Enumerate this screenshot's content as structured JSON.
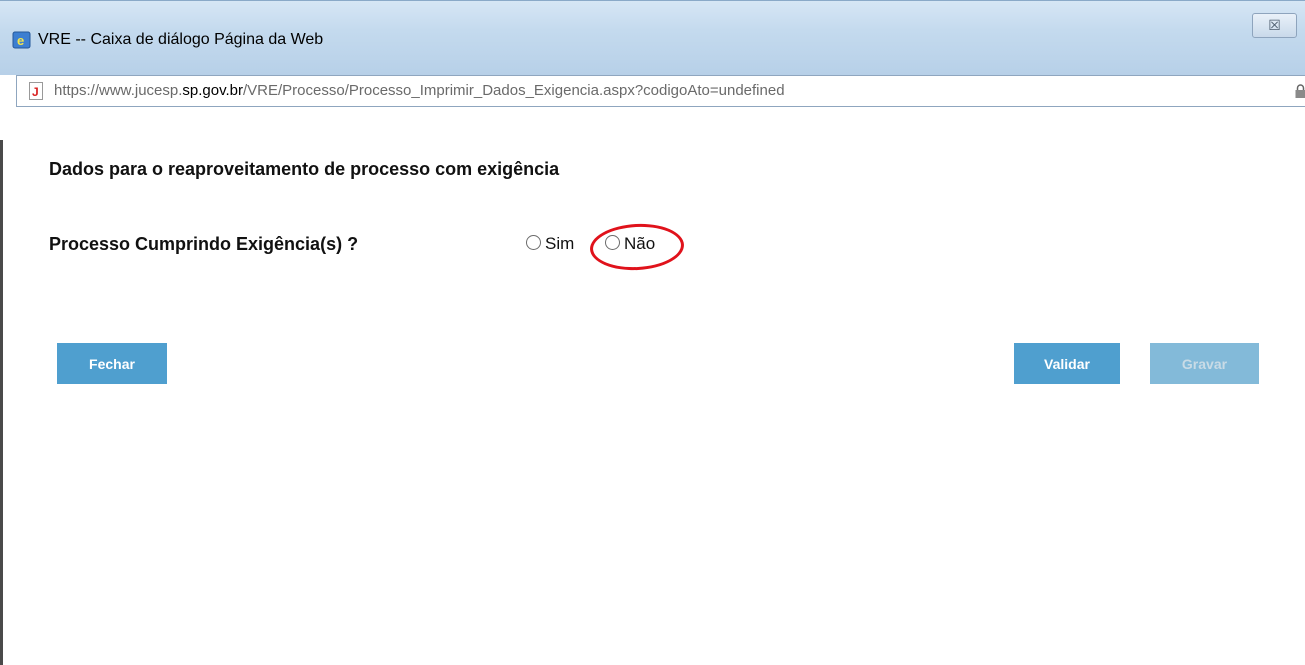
{
  "window": {
    "title": "VRE -- Caixa de diálogo Página da Web",
    "close_glyph": "☒"
  },
  "address_bar": {
    "url_prefix": "https://www.jucesp.",
    "url_host_bold": "sp.gov.br",
    "url_path": "/VRE/Processo/Processo_Imprimir_Dados_Exigencia.aspx?codigoAto=undefined"
  },
  "form": {
    "heading": "Dados para o reaproveitamento de processo com exigência",
    "question_label": "Processo Cumprindo Exigência(s) ?",
    "options": [
      {
        "label": "Sim",
        "selected": false
      },
      {
        "label": "Não",
        "selected": false,
        "highlighted": true
      }
    ]
  },
  "buttons": {
    "close_label": "Fechar",
    "validate_label": "Validar",
    "save_label": "Gravar",
    "save_disabled": true
  },
  "colors": {
    "button_bg": "#4f9fcf",
    "button_disabled_bg": "#83bad9",
    "highlight_ring": "#e0121b"
  }
}
